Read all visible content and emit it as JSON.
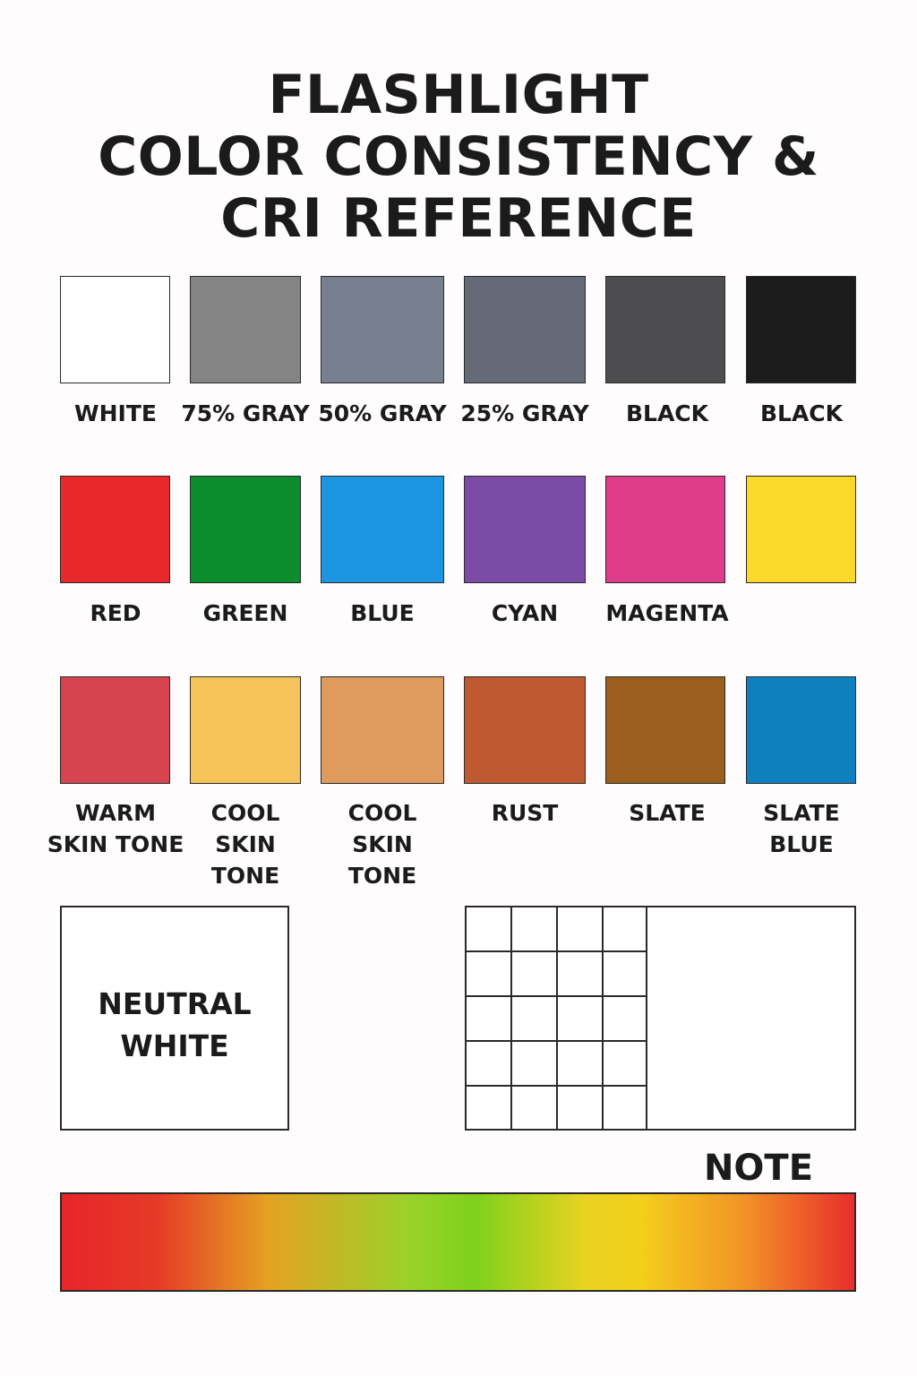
{
  "title": {
    "line1": "FLASHLIGHT",
    "line2": "COLOR CONSISTENCY &",
    "line3": "CRI REFERENCE"
  },
  "rows": [
    [
      {
        "label": "WHITE",
        "color": "#ffffff"
      },
      {
        "label": "75% GRAY",
        "color": "#858484"
      },
      {
        "label": "50% GRAY",
        "color": "#788090"
      },
      {
        "label": "25% GRAY",
        "color": "#646a77"
      },
      {
        "label": "BLACK",
        "color": "#4d4d4f"
      },
      {
        "label": "BLACK",
        "color": "#1c1c1c"
      }
    ],
    [
      {
        "label": "RED",
        "color": "#e8282a"
      },
      {
        "label": "GREEN",
        "color": "#0b8d2d"
      },
      {
        "label": "BLUE",
        "color": "#1d96e2"
      },
      {
        "label": "CYAN",
        "color": "#7c4ba6"
      },
      {
        "label": "MAGENTA",
        "color": "#df3d8c"
      },
      {
        "label": "",
        "color": "#fbd92b"
      }
    ],
    [
      {
        "label": "WARM\nSKIN TONE",
        "color": "#d6444f"
      },
      {
        "label": "COOL\nSKIN\nTONE",
        "color": "#f5c35a"
      },
      {
        "label": "COOL\nSKIN\nTONE",
        "color": "#df9a5e"
      },
      {
        "label": "RUST",
        "color": "#bf5932"
      },
      {
        "label": "SLATE",
        "color": "#9b5f1d"
      },
      {
        "label": "SLATE\nBLUE",
        "color": "#0f80bf"
      }
    ]
  ],
  "neutral_white": {
    "label": "NEUTRAL\nWHITE"
  },
  "note": {
    "label": "NOTE"
  }
}
